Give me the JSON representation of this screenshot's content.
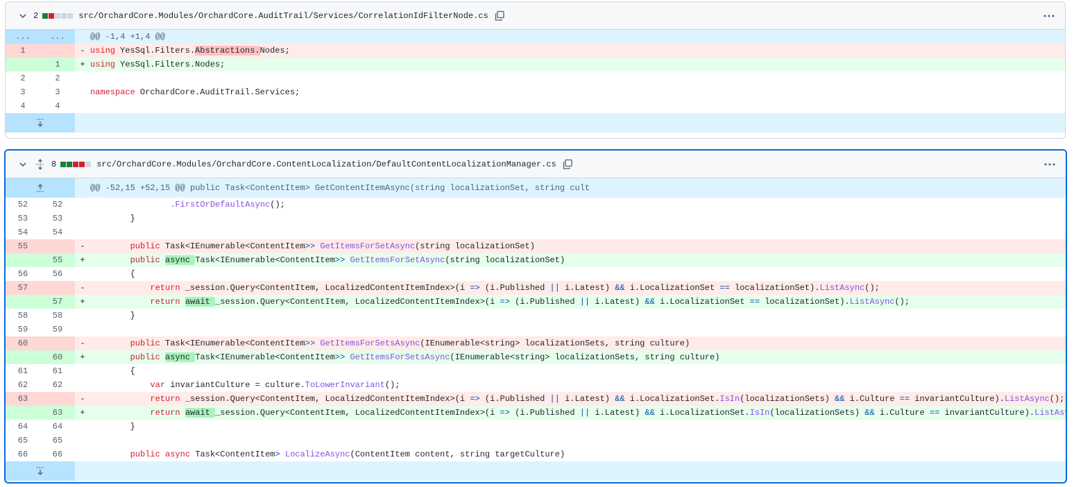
{
  "files": [
    {
      "count": "2",
      "filename": "src/OrchardCore.Modules/OrchardCore.AuditTrail/Services/CorrelationIdFilterNode.cs",
      "diffstat": [
        "add",
        "del",
        "neutral",
        "neutral",
        "neutral"
      ],
      "hunk_old": "...",
      "hunk_new": "...",
      "hunk_header": "@@ -1,4 +1,4 @@",
      "lines": [
        {
          "type": "del",
          "old": "1",
          "new": "",
          "marker": "-",
          "segments": [
            [
              "kw",
              "using"
            ],
            [
              "",
              "YesSql.Filters."
            ],
            [
              "hl-del",
              "Abstractions."
            ],
            [
              "",
              "Nodes;"
            ]
          ]
        },
        {
          "type": "add",
          "old": "",
          "new": "1",
          "marker": "+",
          "segments": [
            [
              "kw",
              "using"
            ],
            [
              "",
              "YesSql.Filters.Nodes;"
            ]
          ]
        },
        {
          "type": "ctx",
          "old": "2",
          "new": "2",
          "marker": "",
          "segments": []
        },
        {
          "type": "ctx",
          "old": "3",
          "new": "3",
          "marker": "",
          "segments": [
            [
              "kw",
              "namespace"
            ],
            [
              "",
              "OrchardCore.AuditTrail.Services;"
            ]
          ]
        },
        {
          "type": "ctx",
          "old": "4",
          "new": "4",
          "marker": "",
          "segments": []
        }
      ]
    },
    {
      "count": "8",
      "filename": "src/OrchardCore.Modules/OrchardCore.ContentLocalization/DefaultContentLocalizationManager.cs",
      "diffstat": [
        "add",
        "add",
        "del",
        "del",
        "neutral"
      ],
      "hunk_header": "@@ -52,15 +52,15 @@ public Task<ContentItem> GetContentItemAsync(string localizationSet, string cult",
      "lines": [
        {
          "type": "ctx",
          "old": "52",
          "new": "52",
          "marker": "",
          "segments": [
            [
              "",
              "                "
            ],
            [
              "fn",
              ".FirstOrDefaultAsync"
            ],
            [
              "",
              "();"
            ]
          ]
        },
        {
          "type": "ctx",
          "old": "53",
          "new": "53",
          "marker": "",
          "segments": [
            [
              "",
              "        }"
            ]
          ]
        },
        {
          "type": "ctx",
          "old": "54",
          "new": "54",
          "marker": "",
          "segments": []
        },
        {
          "type": "del",
          "old": "55",
          "new": "",
          "marker": "-",
          "segments": [
            [
              "",
              "        "
            ],
            [
              "kw",
              "public"
            ],
            [
              "",
              " Task<IEnumerable<ContentItem"
            ],
            [
              "op",
              ">>"
            ],
            [
              "",
              " "
            ],
            [
              "fn",
              "GetItemsForSetAsync"
            ],
            [
              "",
              "(string localizationSet)"
            ]
          ]
        },
        {
          "type": "add",
          "old": "",
          "new": "55",
          "marker": "+",
          "segments": [
            [
              "",
              "        "
            ],
            [
              "kw",
              "public"
            ],
            [
              "",
              " "
            ],
            [
              "hl-add",
              "async "
            ],
            [
              "",
              "Task<IEnumerable<ContentItem"
            ],
            [
              "op",
              ">>"
            ],
            [
              "",
              " "
            ],
            [
              "fn",
              "GetItemsForSetAsync"
            ],
            [
              "",
              "(string localizationSet)"
            ]
          ]
        },
        {
          "type": "ctx",
          "old": "56",
          "new": "56",
          "marker": "",
          "segments": [
            [
              "",
              "        {"
            ]
          ]
        },
        {
          "type": "del",
          "old": "57",
          "new": "",
          "marker": "-",
          "segments": [
            [
              "",
              "            "
            ],
            [
              "kw",
              "return"
            ],
            [
              "",
              " _session.Query<ContentItem, LocalizedContentItemIndex>(i "
            ],
            [
              "op",
              "=>"
            ],
            [
              "",
              " (i.Published "
            ],
            [
              "op",
              "||"
            ],
            [
              "",
              " i.Latest) "
            ],
            [
              "op",
              "&&"
            ],
            [
              "",
              " i.LocalizationSet "
            ],
            [
              "op",
              "=="
            ],
            [
              "",
              " localizationSet)."
            ],
            [
              "fn",
              "ListAsync"
            ],
            [
              "",
              "();"
            ]
          ]
        },
        {
          "type": "add",
          "old": "",
          "new": "57",
          "marker": "+",
          "segments": [
            [
              "",
              "            "
            ],
            [
              "kw",
              "return"
            ],
            [
              "",
              " "
            ],
            [
              "hl-add",
              "await "
            ],
            [
              "",
              "_session.Query<ContentItem, LocalizedContentItemIndex>(i "
            ],
            [
              "op",
              "=>"
            ],
            [
              "",
              " (i.Published "
            ],
            [
              "op",
              "||"
            ],
            [
              "",
              " i.Latest) "
            ],
            [
              "op",
              "&&"
            ],
            [
              "",
              " i.LocalizationSet "
            ],
            [
              "op",
              "=="
            ],
            [
              "",
              " localizationSet)."
            ],
            [
              "fn",
              "ListAsync"
            ],
            [
              "",
              "();"
            ]
          ]
        },
        {
          "type": "ctx",
          "old": "58",
          "new": "58",
          "marker": "",
          "segments": [
            [
              "",
              "        }"
            ]
          ]
        },
        {
          "type": "ctx",
          "old": "59",
          "new": "59",
          "marker": "",
          "segments": []
        },
        {
          "type": "del",
          "old": "60",
          "new": "",
          "marker": "-",
          "segments": [
            [
              "",
              "        "
            ],
            [
              "kw",
              "public"
            ],
            [
              "",
              " Task<IEnumerable<ContentItem"
            ],
            [
              "op",
              ">>"
            ],
            [
              "",
              " "
            ],
            [
              "fn",
              "GetItemsForSetsAsync"
            ],
            [
              "",
              "(IEnumerable<string> localizationSets, string culture)"
            ]
          ]
        },
        {
          "type": "add",
          "old": "",
          "new": "60",
          "marker": "+",
          "segments": [
            [
              "",
              "        "
            ],
            [
              "kw",
              "public"
            ],
            [
              "",
              " "
            ],
            [
              "hl-add",
              "async "
            ],
            [
              "",
              "Task<IEnumerable<ContentItem"
            ],
            [
              "op",
              ">>"
            ],
            [
              "",
              " "
            ],
            [
              "fn",
              "GetItemsForSetsAsync"
            ],
            [
              "",
              "(IEnumerable<string> localizationSets, string culture)"
            ]
          ]
        },
        {
          "type": "ctx",
          "old": "61",
          "new": "61",
          "marker": "",
          "segments": [
            [
              "",
              "        {"
            ]
          ]
        },
        {
          "type": "ctx",
          "old": "62",
          "new": "62",
          "marker": "",
          "segments": [
            [
              "",
              "            "
            ],
            [
              "kw",
              "var"
            ],
            [
              "",
              " invariantCulture = culture."
            ],
            [
              "fn",
              "ToLowerInvariant"
            ],
            [
              "",
              "();"
            ]
          ]
        },
        {
          "type": "del",
          "old": "63",
          "new": "",
          "marker": "-",
          "segments": [
            [
              "",
              "            "
            ],
            [
              "kw",
              "return"
            ],
            [
              "",
              " _session.Query<ContentItem, LocalizedContentItemIndex>(i "
            ],
            [
              "op",
              "=>"
            ],
            [
              "",
              " (i.Published "
            ],
            [
              "op",
              "||"
            ],
            [
              "",
              " i.Latest) "
            ],
            [
              "op",
              "&&"
            ],
            [
              "",
              " i.LocalizationSet."
            ],
            [
              "fn",
              "IsIn"
            ],
            [
              "",
              "(localizationSets) "
            ],
            [
              "op",
              "&&"
            ],
            [
              "",
              " i.Culture "
            ],
            [
              "op",
              "=="
            ],
            [
              "",
              " invariantCulture)."
            ],
            [
              "fn",
              "ListAsync"
            ],
            [
              "",
              "();"
            ]
          ]
        },
        {
          "type": "add",
          "old": "",
          "new": "63",
          "marker": "+",
          "segments": [
            [
              "",
              "            "
            ],
            [
              "kw",
              "return"
            ],
            [
              "",
              " "
            ],
            [
              "hl-add",
              "await "
            ],
            [
              "",
              "_session.Query<ContentItem, LocalizedContentItemIndex>(i "
            ],
            [
              "op",
              "=>"
            ],
            [
              "",
              " (i.Published "
            ],
            [
              "op",
              "||"
            ],
            [
              "",
              " i.Latest) "
            ],
            [
              "op",
              "&&"
            ],
            [
              "",
              " i.LocalizationSet."
            ],
            [
              "fn",
              "IsIn"
            ],
            [
              "",
              "(localizationSets) "
            ],
            [
              "op",
              "&&"
            ],
            [
              "",
              " i.Culture "
            ],
            [
              "op",
              "=="
            ],
            [
              "",
              " invariantCulture)."
            ],
            [
              "fn",
              "ListAsync"
            ],
            [
              "",
              "();"
            ]
          ]
        },
        {
          "type": "ctx",
          "old": "64",
          "new": "64",
          "marker": "",
          "segments": [
            [
              "",
              "        }"
            ]
          ]
        },
        {
          "type": "ctx",
          "old": "65",
          "new": "65",
          "marker": "",
          "segments": []
        },
        {
          "type": "ctx",
          "old": "66",
          "new": "66",
          "marker": "",
          "segments": [
            [
              "",
              "        "
            ],
            [
              "kw",
              "public"
            ],
            [
              "",
              " "
            ],
            [
              "kw",
              "async"
            ],
            [
              "",
              " Task<ContentItem"
            ],
            [
              "op",
              ">"
            ],
            [
              "",
              " "
            ],
            [
              "fn",
              "LocalizeAsync"
            ],
            [
              "",
              "(ContentItem content, string targetCulture)"
            ]
          ]
        }
      ]
    }
  ],
  "colors": {
    "add": "#1a7f37",
    "del": "#cf222e",
    "neutral": "#d0d7de",
    "accent": "#0969da"
  },
  "icons": [
    "chevron-down-icon",
    "unfold-icon",
    "copy-icon",
    "kebab-horizontal-icon",
    "fold-down-icon",
    "fold-up-icon"
  ]
}
